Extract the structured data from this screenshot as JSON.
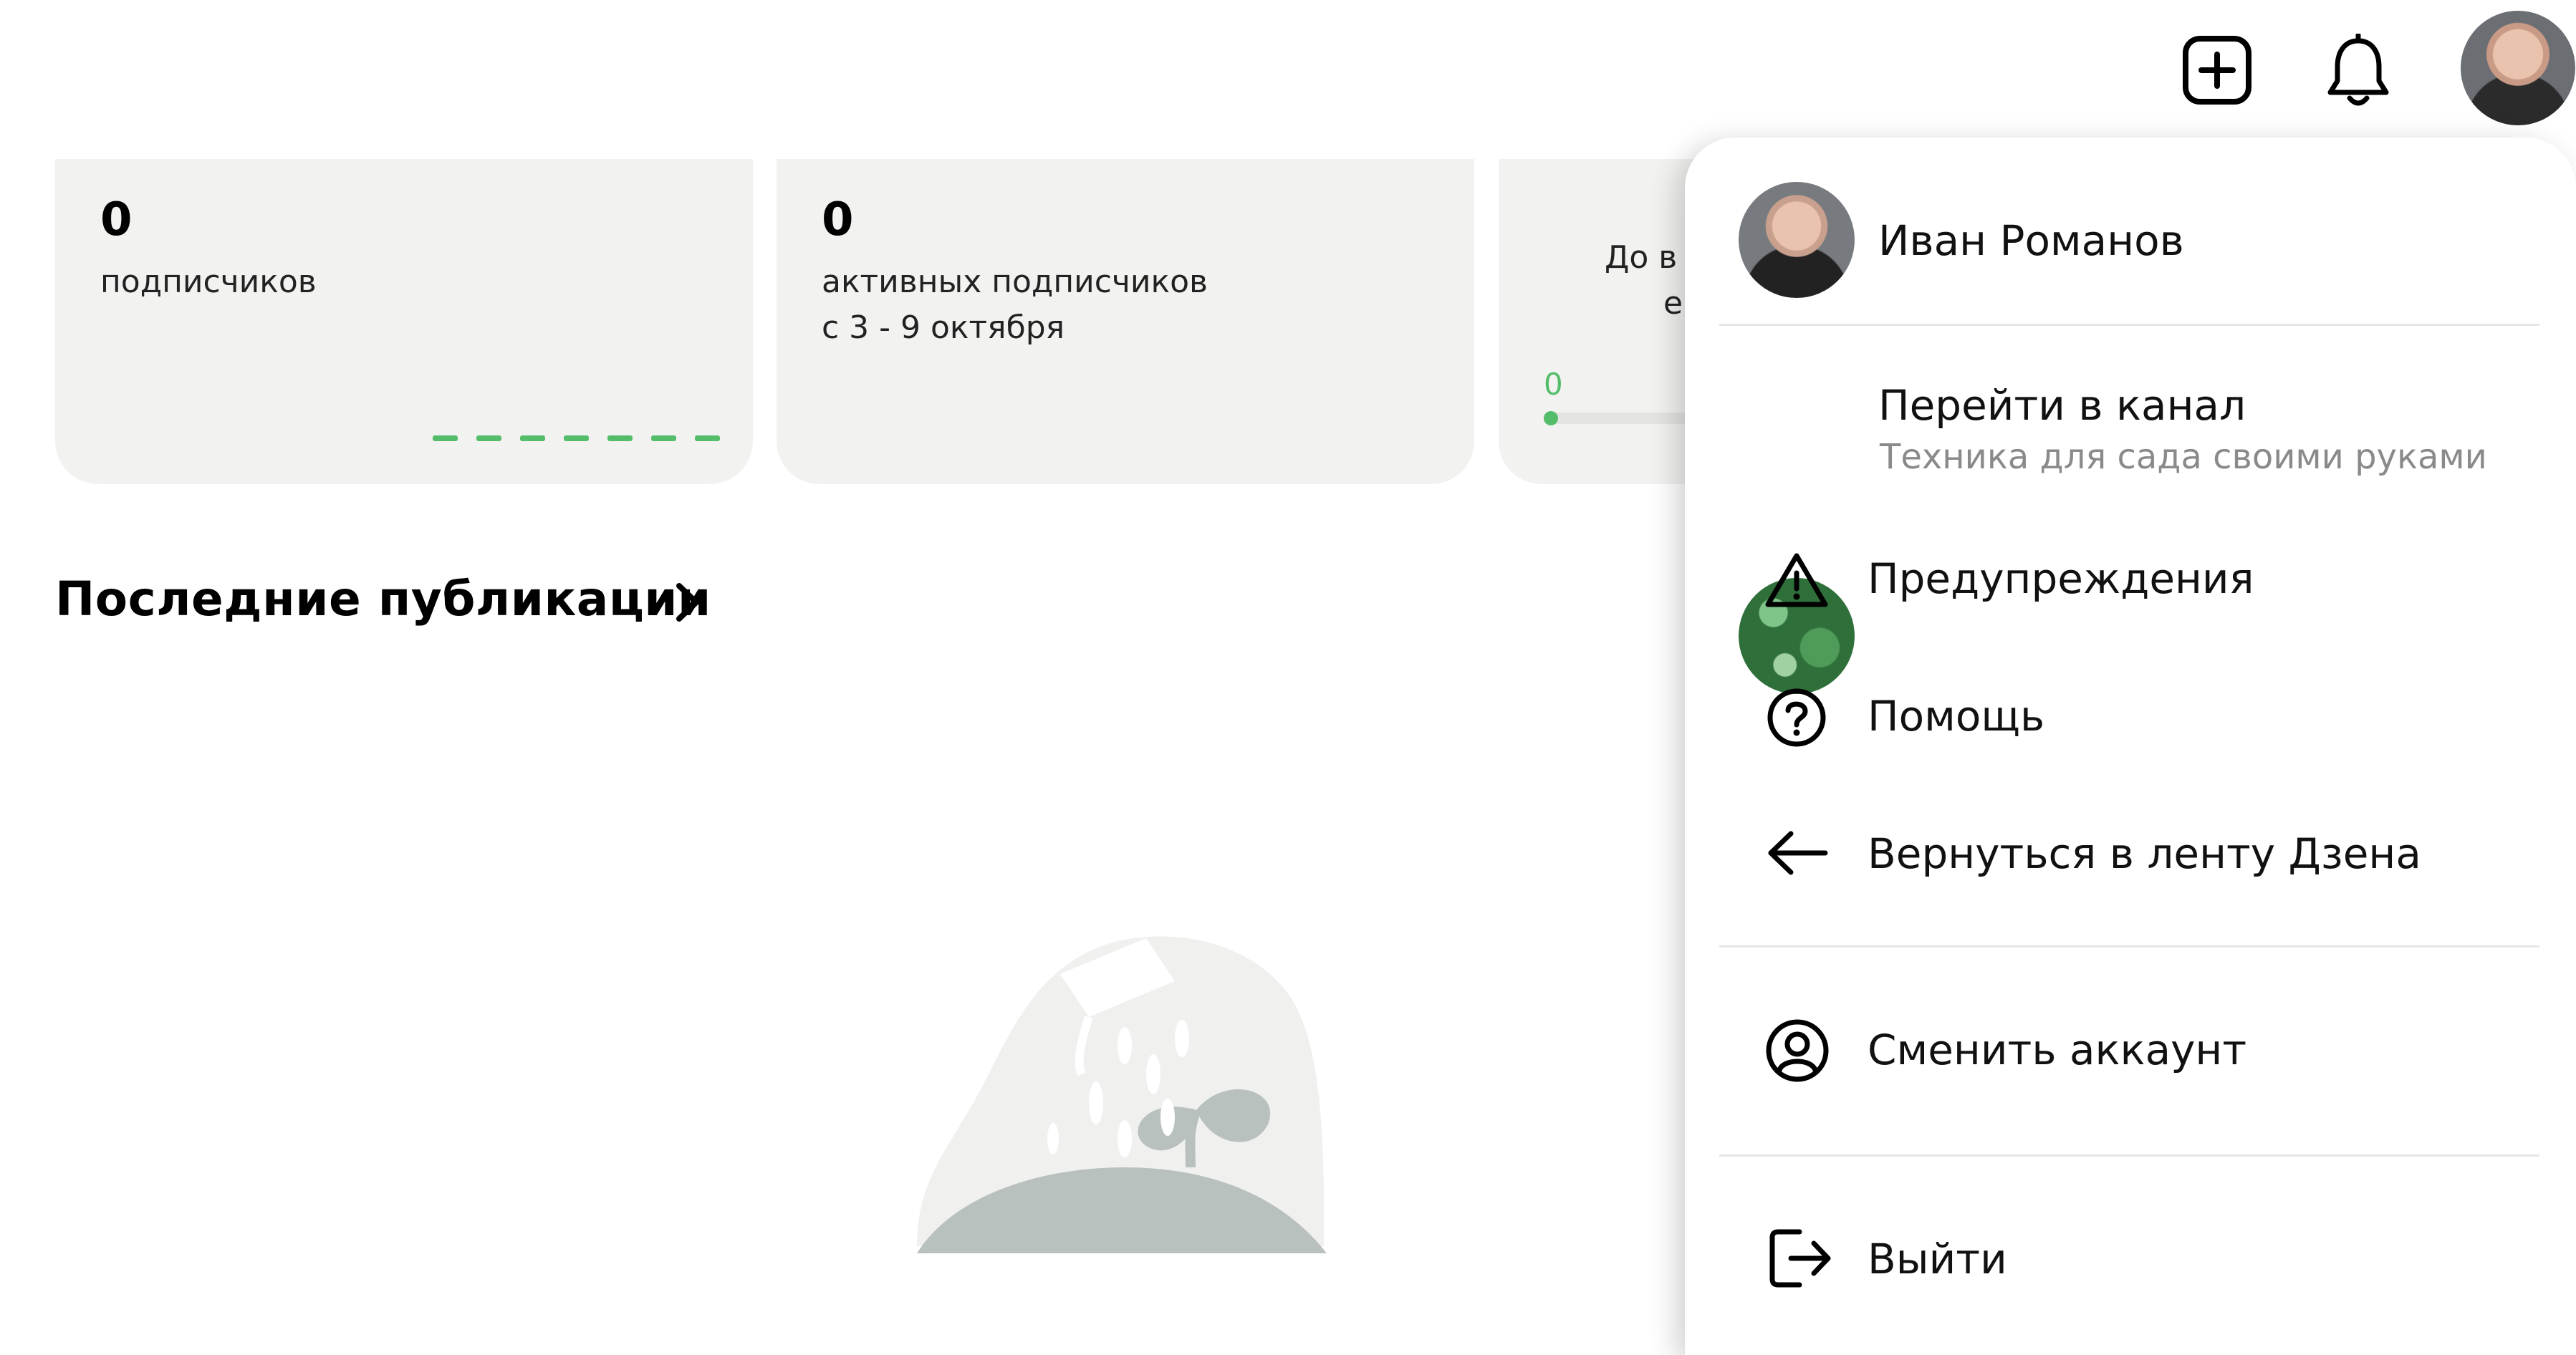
{
  "cards": [
    {
      "value": "0",
      "label": "подписчиков"
    },
    {
      "value": "0",
      "label_line1": "активных подписчиков",
      "label_line2": "с 3 - 9 октября"
    },
    {
      "label_line1": "До в",
      "label_line2": "е",
      "progress_value": "0"
    }
  ],
  "section": {
    "title": "Последние публикации"
  },
  "menu": {
    "user_name": "Иван Романов",
    "channel_label": "Перейти в канал",
    "channel_name": "Техника для сада своими руками",
    "warnings": "Предупреждения",
    "help": "Помощь",
    "back": "Вернуться в ленту Дзена",
    "switch": "Сменить аккаунт",
    "logout": "Выйти"
  },
  "colors": {
    "accent_green": "#54bd6a",
    "card_bg": "#f2f2f0"
  }
}
